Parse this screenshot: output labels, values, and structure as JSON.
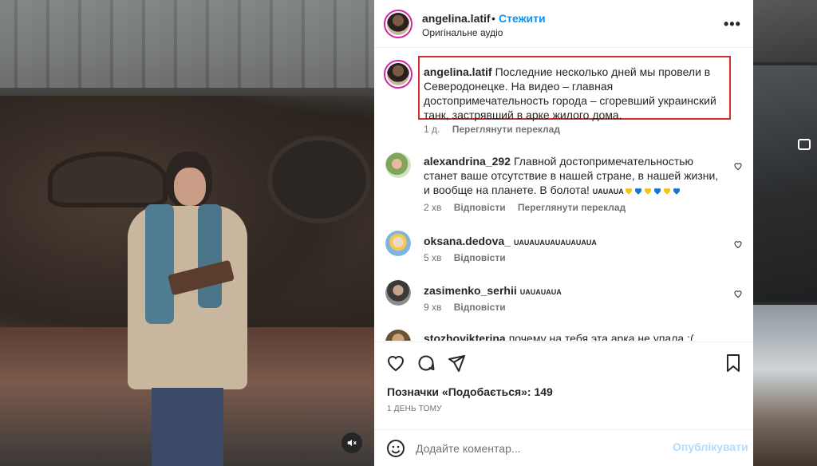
{
  "post": {
    "username": "angelina.latif",
    "follow_label": "Стежити",
    "separator": "•",
    "audio": "Оригінальне аудіо",
    "more_label": "•••"
  },
  "caption": {
    "username": "angelina.latif",
    "text": "Последние несколько дней мы провели в Северодонецке. На видео – главная достопримечательность города – сгоревший украинский танк, застрявший в арке жилого дома.",
    "age": "1 д.",
    "translate": "Переглянути переклад"
  },
  "comments": [
    {
      "username": "alexandrina_292",
      "text": "Главной достопримечательностью станет ваше отсутствие в нашей стране, в нашей жизни, и вообще на планете. В болота!",
      "tag": "UAUAUA",
      "hearts": [
        "yellow",
        "blue",
        "yellow",
        "blue",
        "yellow",
        "blue"
      ],
      "age": "2 хв",
      "reply": "Відповісти",
      "translate": "Переглянути переклад"
    },
    {
      "username": "oksana.dedova_",
      "text": "",
      "tag": "UAUAUAUAUAUAUAUA",
      "age": "5 хв",
      "reply": "Відповісти"
    },
    {
      "username": "zasimenko_serhii",
      "text": "",
      "tag": "UAUAUAUA",
      "age": "9 хв",
      "reply": "Відповісти"
    },
    {
      "username": "stozhovikterina",
      "text": "почему на тебя эта арка не упала :("
    }
  ],
  "likes": {
    "text": "Позначки «Подобається»: 149"
  },
  "timestamp": "1 ДЕНЬ ТОМУ",
  "comment_box": {
    "placeholder": "Додайте коментар...",
    "post_label": "Опублікувати"
  },
  "colors": {
    "accent": "#0095f6",
    "highlight_border": "#d32f2f",
    "heart_yellow": "#f5c518",
    "heart_blue": "#1877d2"
  }
}
